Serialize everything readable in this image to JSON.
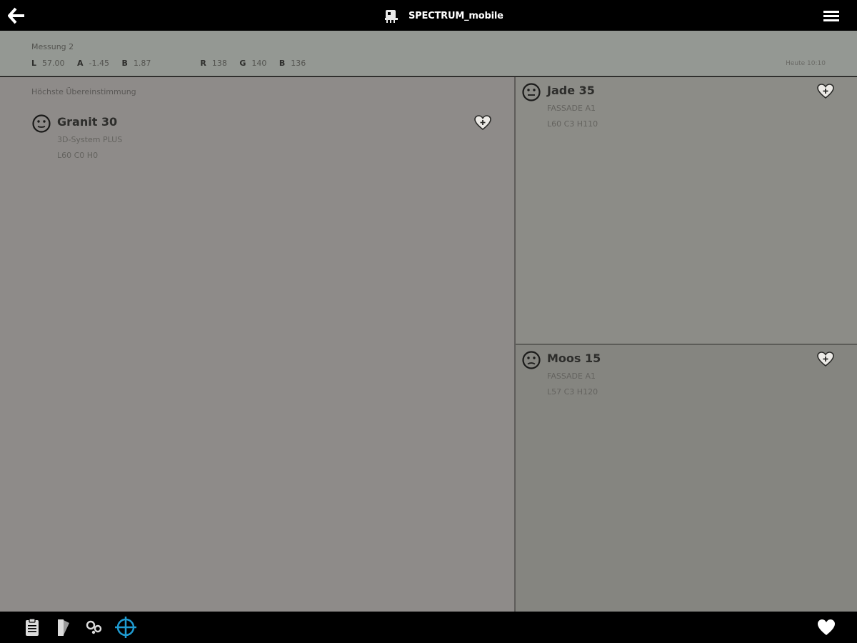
{
  "header": {
    "title": "SPECTRUM_mobile",
    "back_icon": "arrow-left-icon",
    "logo_icon": "spectrum-logo-icon",
    "menu_icon": "hamburger-menu-icon"
  },
  "measurement": {
    "title": "Messung 2",
    "lab": [
      {
        "key": "L",
        "value": "57.00"
      },
      {
        "key": "A",
        "value": "-1.45"
      },
      {
        "key": "B",
        "value": "1.87"
      }
    ],
    "rgb": [
      {
        "key": "R",
        "value": "138"
      },
      {
        "key": "G",
        "value": "140"
      },
      {
        "key": "B",
        "value": "136"
      }
    ],
    "note": "Heute 10:10"
  },
  "main": {
    "section_label": "Höchste Übereinstimmung",
    "best_match": {
      "name": "Granit 30",
      "system": "3D-System PLUS",
      "code": "L60 C0 H0",
      "face_icon": "neutral-face-icon",
      "favorite_icon": "heart-plus-icon",
      "swatch_color": "#8e8b89"
    }
  },
  "alternatives": [
    {
      "name": "Jade 35",
      "system": "FASSADE A1",
      "code": "L60 C3 H110",
      "face_icon": "neutral-face-icon",
      "favorite_icon": "heart-plus-icon",
      "swatch_color": "#8c8c87"
    },
    {
      "name": "Moos 15",
      "system": "FASSADE A1",
      "code": "L57 C3 H120",
      "face_icon": "sad-face-icon",
      "favorite_icon": "heart-plus-icon",
      "swatch_color": "#858580"
    }
  ],
  "toolbar": {
    "items": [
      "clipboard-icon",
      "color-fan-icon",
      "color-wheels-icon",
      "crosshair-icon",
      "heart-icon"
    ],
    "active_color": "#1f9bd1"
  }
}
